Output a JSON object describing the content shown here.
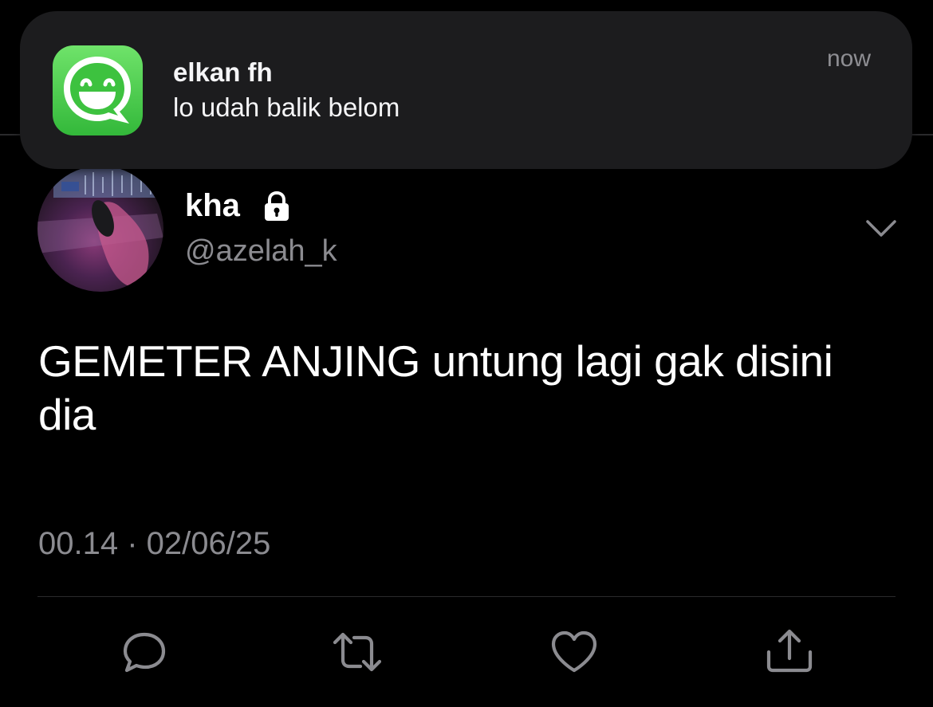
{
  "notification": {
    "app_icon": "messenger-smiley-icon",
    "sender": "elkan fh",
    "message": "lo udah balik belom",
    "time": "now"
  },
  "tweet": {
    "display_name": "kha",
    "handle": "@azelah_k",
    "protected_icon": "lock-icon",
    "text": "GEMETER ANJING untung lagi gak disini dia",
    "timestamp": "00.14 · 02/06/25",
    "more_icon": "chevron-down-icon"
  },
  "actions": [
    {
      "icon": "reply-icon"
    },
    {
      "icon": "retweet-icon"
    },
    {
      "icon": "like-icon"
    },
    {
      "icon": "share-icon"
    }
  ],
  "colors": {
    "background": "#000000",
    "notification_bg": "#1c1c1e",
    "app_icon_green": "#4cd04c",
    "secondary_text": "#8b8b90",
    "divider": "#2a2a2c"
  }
}
